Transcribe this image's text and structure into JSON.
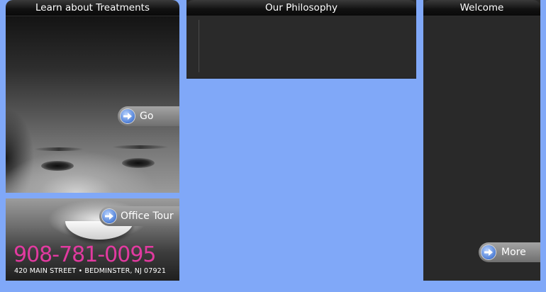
{
  "treatments": {
    "title": "Learn about Treatments",
    "go_label": "Go"
  },
  "tour": {
    "button_label": "Office Tour",
    "phone": "908-781-0095",
    "address": "420 MAIN STREET • BEDMINSTER, NJ 07921"
  },
  "philosophy": {
    "title": "Our Philosophy"
  },
  "welcome": {
    "title": "Welcome",
    "more_label": "More"
  },
  "icons": {
    "arrow": "arrow-right-icon"
  },
  "colors": {
    "background": "#80a8f8",
    "panel": "#292929",
    "phone": "#e23aa0",
    "arrow_blue": "#4f7fd6"
  }
}
